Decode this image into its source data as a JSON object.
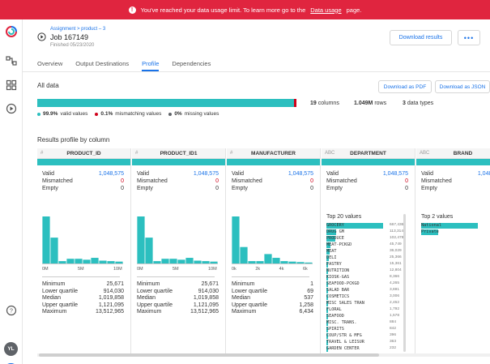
{
  "banner": {
    "text_before": "You've reached your data usage limit. To learn more go to the",
    "link": "Data usage",
    "text_after": "page."
  },
  "sidebar": {
    "avatar_initials": "YL",
    "icons": [
      "logo-icon",
      "flows-icon",
      "dashboard-icon",
      "jobs-icon",
      "help-icon",
      "chat-icon"
    ]
  },
  "header": {
    "breadcrumb": "Assignment > product – 3",
    "job_title": "Job 167149",
    "finished": "Finished 05/23/2020",
    "download_button": "Download results",
    "more_button": "•••"
  },
  "tabs": [
    {
      "label": "Overview",
      "active": false
    },
    {
      "label": "Output Destinations",
      "active": false
    },
    {
      "label": "Profile",
      "active": true
    },
    {
      "label": "Dependencies",
      "active": false
    }
  ],
  "all_data": {
    "title": "All data",
    "pdf_button": "Download as PDF",
    "json_button": "Download as JSON",
    "valid_pct": 99.9,
    "mismatch_pct": 0.1,
    "columns_num": "19",
    "columns_lbl": "columns",
    "rows_num": "1.049M",
    "rows_lbl": "rows",
    "types_num": "3",
    "types_lbl": "data types",
    "legend_valid_num": "99.9%",
    "legend_valid_lbl": "valid values",
    "legend_mis_num": "0.1%",
    "legend_mis_lbl": "mismatching values",
    "legend_missing_num": "0%",
    "legend_missing_lbl": "missing values",
    "colors": {
      "valid": "#2cbfbf",
      "mismatch": "#d0021b",
      "missing": "#5f6368"
    }
  },
  "results": {
    "title": "Results profile by column",
    "labels": {
      "valid": "Valid",
      "mismatched": "Mismatched",
      "empty": "Empty",
      "minimum": "Minimum",
      "lower_quartile": "Lower quartile",
      "median": "Median",
      "upper_quartile": "Upper quartile",
      "maximum": "Maximum"
    },
    "columns": [
      {
        "type": "#",
        "name": "PRODUCT_ID",
        "valid": "1,048,575",
        "mismatched": "0",
        "empty": "0",
        "hist": [
          1.0,
          0.55,
          0.05,
          0.1,
          0.1,
          0.08,
          0.12,
          0.06,
          0.05,
          0.04
        ],
        "axis": [
          "0M",
          "5M",
          "10M"
        ],
        "stats": {
          "minimum": "25,671",
          "lower_quartile": "914,030",
          "median": "1,019,858",
          "upper_quartile": "1,121,095",
          "maximum": "13,512,965"
        }
      },
      {
        "type": "#",
        "name": "PRODUCT_ID1",
        "valid": "1,048,575",
        "mismatched": "0",
        "empty": "0",
        "hist": [
          1.0,
          0.55,
          0.05,
          0.1,
          0.1,
          0.08,
          0.12,
          0.06,
          0.05,
          0.04
        ],
        "axis": [
          "0M",
          "5M",
          "10M"
        ],
        "stats": {
          "minimum": "25,671",
          "lower_quartile": "914,030",
          "median": "1,019,858",
          "upper_quartile": "1,121,095",
          "maximum": "13,512,965"
        }
      },
      {
        "type": "#",
        "name": "MANUFACTURER",
        "valid": "1,048,575",
        "mismatched": "0",
        "empty": "0",
        "hist": [
          1.0,
          0.35,
          0.05,
          0.05,
          0.2,
          0.12,
          0.05,
          0.04,
          0.03,
          0.02
        ],
        "axis": [
          "0k",
          "2k",
          "4k",
          "6k"
        ],
        "stats": {
          "minimum": "1",
          "lower_quartile": "69",
          "median": "537",
          "upper_quartile": "1,258",
          "maximum": "6,434"
        }
      },
      {
        "type": "ABC",
        "name": "DEPARTMENT",
        "valid": "1,048,575",
        "mismatched": "0",
        "empty": "0",
        "top_title": "Top 20 values",
        "top": [
          {
            "label": "GROCERY",
            "count": "667,436",
            "frac": 1.0
          },
          {
            "label": "DRUG GM",
            "count": "113,314",
            "frac": 0.17
          },
          {
            "label": "PRODUCE",
            "count": "102,478",
            "frac": 0.15
          },
          {
            "label": "MEAT-PCKGD",
            "count": "45,749",
            "frac": 0.07
          },
          {
            "label": "MEAT",
            "count": "36,029",
            "frac": 0.05
          },
          {
            "label": "DELI",
            "count": "25,366",
            "frac": 0.04
          },
          {
            "label": "PASTRY",
            "count": "15,361",
            "frac": 0.02
          },
          {
            "label": "NUTRITION",
            "count": "12,804",
            "frac": 0.02
          },
          {
            "label": "KIOSK-GAS",
            "count": "8,366",
            "frac": 0.01
          },
          {
            "label": "SEAFOOD-PCKGD",
            "count": "4,265",
            "frac": 0.01
          },
          {
            "label": "SALAD BAR",
            "count": "3,691",
            "frac": 0.01
          },
          {
            "label": "COSMETICS",
            "count": "3,006",
            "frac": 0.005
          },
          {
            "label": "MISC SALES TRAN",
            "count": "2,452",
            "frac": 0.004
          },
          {
            "label": "FLORAL",
            "count": "1,792",
            "frac": 0.003
          },
          {
            "label": "SEAFOOD",
            "count": "1,578",
            "frac": 0.002
          },
          {
            "label": "MISC. TRANS.",
            "count": "884",
            "frac": 0.002
          },
          {
            "label": "SPIRITS",
            "count": "842",
            "frac": 0.002
          },
          {
            "label": "COUP/STR & MFG",
            "count": "396",
            "frac": 0.001
          },
          {
            "label": "TRAVEL & LEISUR",
            "count": "363",
            "frac": 0.001
          },
          {
            "label": "GARDEN CENTER",
            "count": "232",
            "frac": 0.001
          }
        ]
      },
      {
        "type": "ABC",
        "name": "BRAND",
        "valid": "1,048,575",
        "mismatched": "0",
        "empty": "0",
        "top_title": "Top 2 values",
        "top": [
          {
            "label": "National",
            "count": "",
            "frac": 1.0
          },
          {
            "label": "Private",
            "count": "",
            "frac": 0.3
          }
        ]
      }
    ]
  }
}
